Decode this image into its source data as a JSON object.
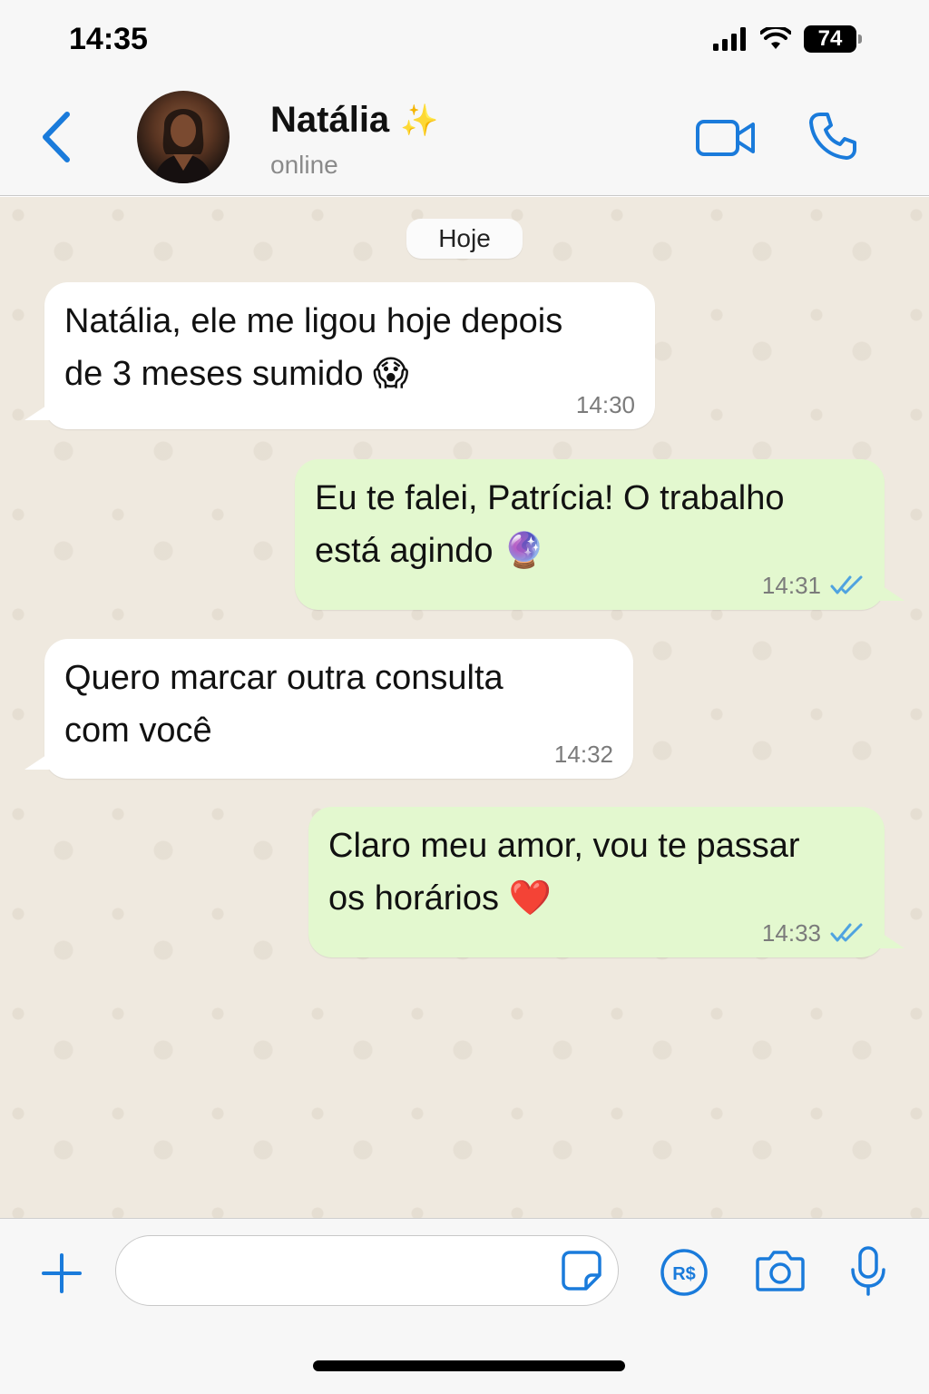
{
  "status_bar": {
    "time": "14:35",
    "battery": "74",
    "icons": [
      "cellular-signal-icon",
      "wifi-icon",
      "battery-icon"
    ]
  },
  "header": {
    "contact_name": "Natália",
    "name_emoji": "✨",
    "status": "online",
    "icons": [
      "back-chevron-icon",
      "avatar",
      "video-call-icon",
      "phone-call-icon"
    ],
    "accent_color": "#1a7bdb"
  },
  "chat": {
    "date_label": "Hoje",
    "messages": [
      {
        "direction": "in",
        "text_line1": "Natália, ele me ligou hoje depois",
        "text_line2": "de 3 meses sumido 😱",
        "time": "14:30"
      },
      {
        "direction": "out",
        "text_line1": "Eu te falei, Patrícia! O trabalho",
        "text_line2": "está agindo 🔮",
        "time": "14:31",
        "read": true
      },
      {
        "direction": "in",
        "text_line1": "Quero marcar outra consulta",
        "text_line2": "com você",
        "time": "14:32"
      },
      {
        "direction": "out",
        "text_line1": "Claro meu amor, vou te passar",
        "text_line2": "os horários ❤️",
        "time": "14:33",
        "read": true
      }
    ],
    "colors": {
      "incoming": "#ffffff",
      "outgoing": "#e3f8cf",
      "background": "#efe9df",
      "read_ticks": "#4fa3e0"
    }
  },
  "input_bar": {
    "placeholder": "",
    "icons": [
      "plus-icon",
      "sticker-icon",
      "payment-real-icon",
      "camera-icon",
      "microphone-icon"
    ],
    "payment_label": "R$"
  }
}
